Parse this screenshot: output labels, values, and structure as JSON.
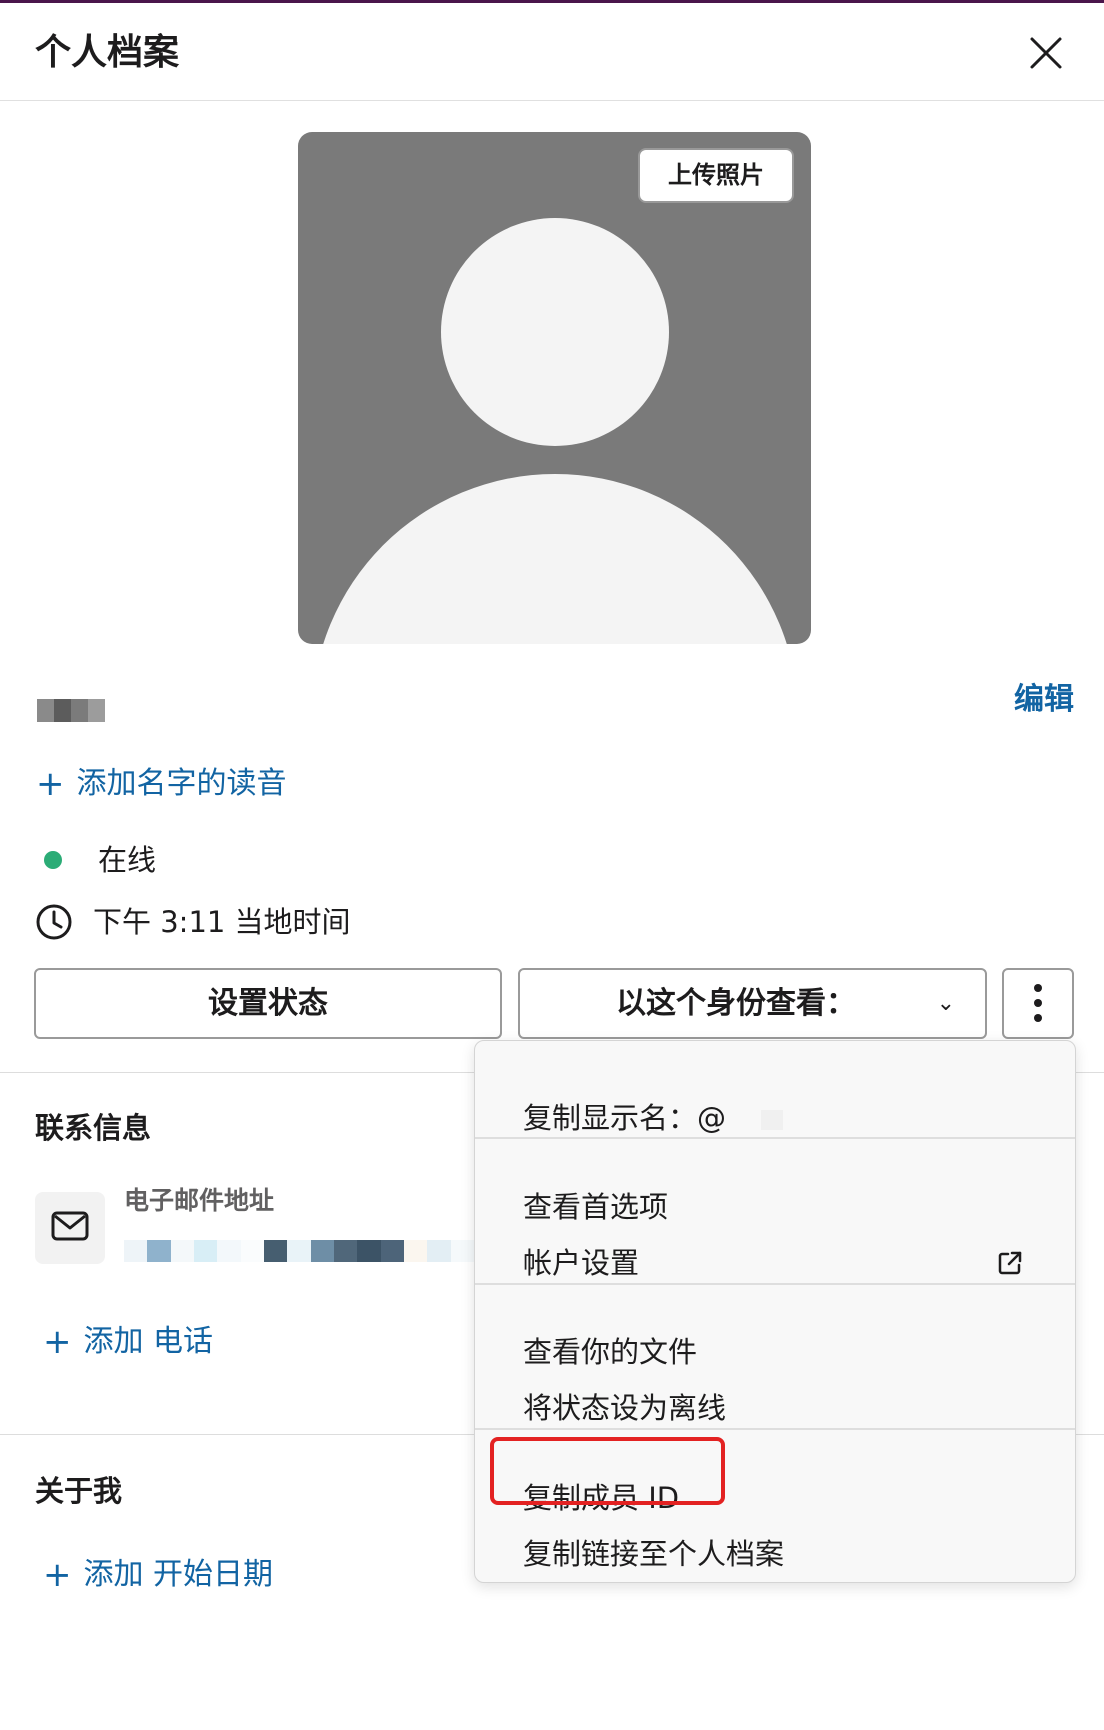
{
  "header": {
    "title": "个人档案"
  },
  "photo": {
    "upload_label": "上传照片"
  },
  "profile": {
    "edit_label": "编辑",
    "add_pronunciation": "添加名字的读音",
    "status": "在线",
    "local_time": "下午 3:11 当地时间"
  },
  "actions": {
    "set_status": "设置状态",
    "view_as": "以这个身份查看："
  },
  "contact": {
    "title": "联系信息",
    "email_label": "电子邮件地址",
    "add_phone": "添加 电话"
  },
  "about": {
    "title": "关于我",
    "add_start_date": "添加 开始日期"
  },
  "menu": {
    "copy_display_name": "复制显示名：@",
    "view_preferences": "查看首选项",
    "account_settings": "帐户设置",
    "view_files": "查看你的文件",
    "set_away": "将状态设为离线",
    "copy_member_id": "复制成员 ID",
    "copy_profile_link": "复制链接至个人档案"
  },
  "colors": {
    "link": "#1264a3",
    "online": "#2bac76",
    "highlight": "#e32222",
    "brand_bar": "#4a154b"
  },
  "icons": {
    "close": "close-icon",
    "clock": "clock-icon",
    "email": "mail-icon",
    "external": "external-link-icon",
    "more": "vertical-ellipsis-icon",
    "chevron": "chevron-down-icon"
  }
}
